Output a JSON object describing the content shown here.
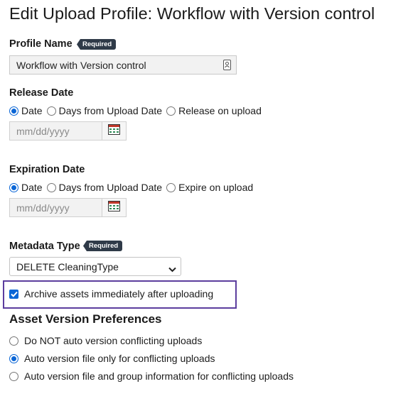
{
  "page": {
    "title": "Edit Upload Profile: Workflow with Version control"
  },
  "profile_name": {
    "label": "Profile Name",
    "required_badge": "Required",
    "value": "Workflow with Version control"
  },
  "release_date": {
    "label": "Release Date",
    "options": [
      {
        "label": "Date",
        "selected": true
      },
      {
        "label": "Days from Upload Date",
        "selected": false
      },
      {
        "label": "Release on upload",
        "selected": false
      }
    ],
    "date_placeholder": "mm/dd/yyyy"
  },
  "expiration_date": {
    "label": "Expiration Date",
    "options": [
      {
        "label": "Date",
        "selected": true
      },
      {
        "label": "Days from Upload Date",
        "selected": false
      },
      {
        "label": "Expire on upload",
        "selected": false
      }
    ],
    "date_placeholder": "mm/dd/yyyy"
  },
  "metadata_type": {
    "label": "Metadata Type",
    "required_badge": "Required",
    "selected": "DELETE CleaningType"
  },
  "archive": {
    "label": "Archive assets immediately after uploading",
    "checked": true,
    "highlight_color": "#5c3d9e"
  },
  "version_prefs": {
    "title": "Asset Version Preferences",
    "options": [
      {
        "label": "Do NOT auto version conflicting uploads",
        "selected": false
      },
      {
        "label": "Auto version file only for conflicting uploads",
        "selected": true
      },
      {
        "label": "Auto version file and group information for conflicting uploads",
        "selected": false
      }
    ]
  },
  "icons": {
    "profile_field": "contact-card-icon",
    "calendar": "calendar-icon",
    "select": "chevron-down-icon",
    "checkbox": "checkmark-icon"
  },
  "colors": {
    "accent": "#0a66d6",
    "badge": "#2f3a48"
  }
}
